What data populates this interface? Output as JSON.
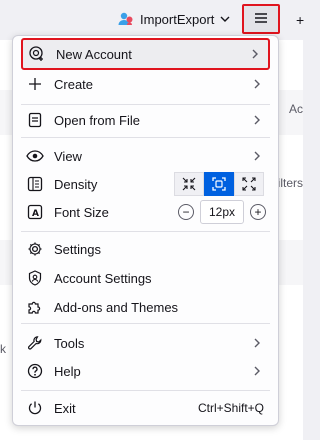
{
  "toolbar": {
    "account_label": "ImportExport"
  },
  "background": {
    "right_text_1": "Ac",
    "right_text_2": "ilters",
    "left_text": "k"
  },
  "menu": {
    "new_account": "New Account",
    "create": "Create",
    "open_from_file": "Open from File",
    "view": "View",
    "density": "Density",
    "font_size": "Font Size",
    "font_size_value": "12px",
    "settings": "Settings",
    "account_settings": "Account Settings",
    "addons": "Add-ons and Themes",
    "tools": "Tools",
    "help": "Help",
    "exit": "Exit",
    "exit_shortcut": "Ctrl+Shift+Q"
  },
  "colors": {
    "accent": "#0061e0",
    "highlight_border": "#e0141e"
  }
}
